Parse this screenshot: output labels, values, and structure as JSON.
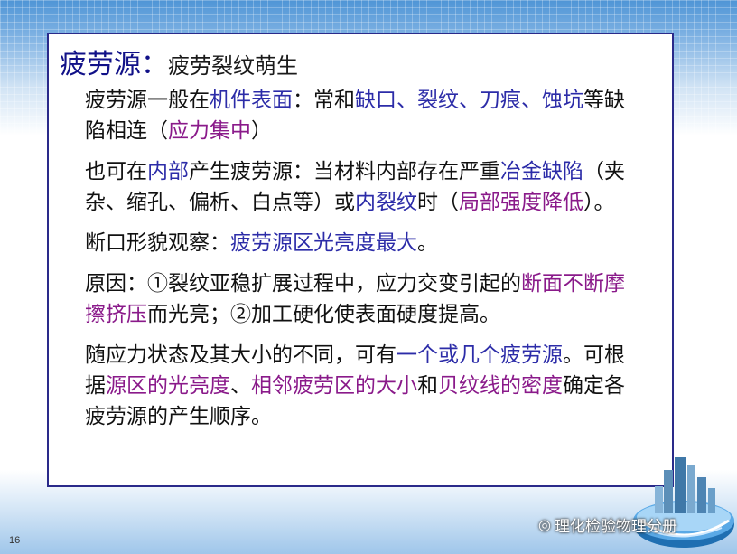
{
  "title": {
    "head": "疲劳源：",
    "tail": "疲劳裂纹萌生"
  },
  "p1": {
    "a": "疲劳源一般在",
    "b": "机件表面",
    "c": "：常和",
    "d": "缺口、裂纹、刀痕、蚀坑",
    "e": "等缺陷相连（",
    "f": "应力集中",
    "g": "）"
  },
  "p2": {
    "a": "也可在",
    "b": "内部",
    "c": "产生疲劳源：当材料内部存在严重",
    "d": "冶金缺陷",
    "e": "（夹杂、缩孔、偏析、白点等）或",
    "f": "内裂纹",
    "g": "时（",
    "h": "局部强度降低",
    "i": "）。"
  },
  "p3": {
    "a": "断口形貌观察：",
    "b": "疲劳源区光亮度最大",
    "c": "。"
  },
  "p4": {
    "a": "原因：①裂纹亚稳扩展过程中，应力交变引起的",
    "b": "断面不断摩擦挤压",
    "c": "而光亮；②加工硬化使表面硬度提高。"
  },
  "p5": {
    "a": "随应力状态及其大小的不同，可有",
    "b": "一个或几个疲劳源",
    "c": "。可根据",
    "d": "源区的光亮度",
    "e": "、",
    "f": "相邻疲劳区的大小",
    "g": "和",
    "h": "贝纹线的密度",
    "i": "确定各疲劳源的产生顺序。"
  },
  "page_number": "16",
  "watermark": "理化检验物理分册",
  "colors": {
    "blue": "#2c2ca8",
    "purple": "#8a1a8a",
    "border": "#2a2a8a"
  }
}
